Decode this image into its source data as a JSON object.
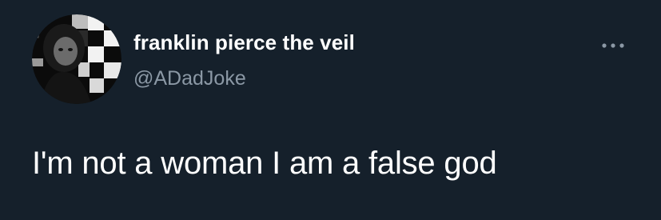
{
  "theme": {
    "background": "#15202b",
    "text_primary": "#ffffff",
    "text_secondary": "#8b98a5"
  },
  "author": {
    "display_name": "franklin pierce the veil",
    "handle": "@ADadJoke",
    "avatar_icon": "profile-photo-checkerboard"
  },
  "menu": {
    "icon": "more-options-icon"
  },
  "tweet": {
    "text": "I'm not a woman I am a false god"
  }
}
